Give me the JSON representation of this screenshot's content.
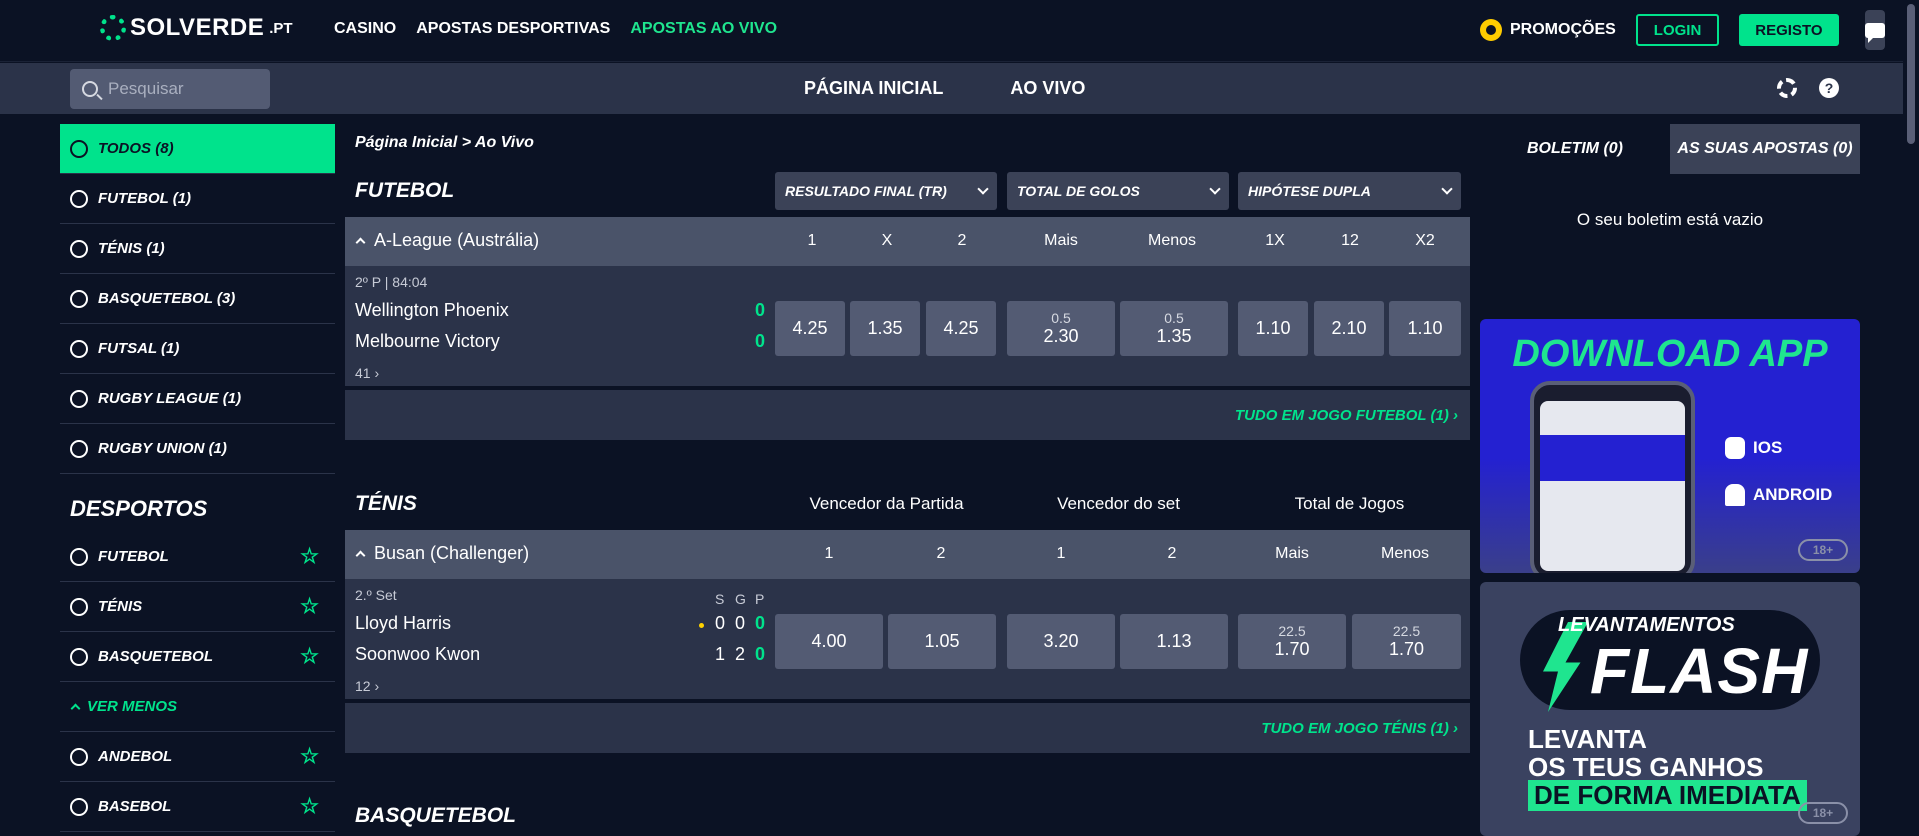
{
  "topnav": {
    "logo": "SOLVERDE",
    "logo_suffix": ".PT",
    "links": [
      "CASINO",
      "APOSTAS DESPORTIVAS",
      "APOSTAS AO VIVO"
    ],
    "active_link": 2,
    "promo": "PROMOÇÕES",
    "login": "LOGIN",
    "register": "REGISTO"
  },
  "subnav": {
    "search_placeholder": "Pesquisar",
    "tabs": [
      "PÁGINA INICIAL",
      "AO VIVO"
    ]
  },
  "sidebar": {
    "live_items": [
      {
        "label": "TODOS (8)",
        "icon": "all-sports-icon",
        "active": true
      },
      {
        "label": "FUTEBOL (1)",
        "icon": "football-icon"
      },
      {
        "label": "TÉNIS (1)",
        "icon": "tennis-icon"
      },
      {
        "label": "BASQUETEBOL (3)",
        "icon": "basketball-icon"
      },
      {
        "label": "FUTSAL (1)",
        "icon": "futsal-icon"
      },
      {
        "label": "RUGBY LEAGUE (1)",
        "icon": "rugby-icon"
      },
      {
        "label": "RUGBY UNION (1)",
        "icon": "rugby-icon"
      }
    ],
    "sports_title": "DESPORTOS",
    "sports": [
      {
        "label": "FUTEBOL",
        "icon": "football-icon"
      },
      {
        "label": "TÉNIS",
        "icon": "tennis-icon"
      },
      {
        "label": "BASQUETEBOL",
        "icon": "basketball-icon"
      }
    ],
    "ver_menos": "VER MENOS",
    "more_sports": [
      {
        "label": "ANDEBOL",
        "icon": "handball-icon"
      },
      {
        "label": "BASEBOL",
        "icon": "baseball-icon"
      }
    ]
  },
  "main": {
    "breadcrumb": "Página Inicial > Ao Vivo",
    "football": {
      "title": "FUTEBOL",
      "dropdowns": [
        "RESULTADO FINAL (TR)",
        "TOTAL DE GOLOS",
        "HIPÓTESE DUPLA"
      ],
      "league": "A-League (Austrália)",
      "columns": [
        "1",
        "X",
        "2",
        "Mais",
        "Menos",
        "1X",
        "12",
        "X2"
      ],
      "period": "2º P",
      "time": "84:04",
      "home": "Wellington Phoenix",
      "away": "Melbourne Victory",
      "home_score": "0",
      "away_score": "0",
      "more": "41",
      "odds": [
        "4.25",
        "1.35",
        "4.25",
        "2.30",
        "1.35",
        "1.10",
        "2.10",
        "1.10"
      ],
      "lines": [
        "0.5",
        "0.5"
      ],
      "all_link": "TUDO EM JOGO FUTEBOL (1)"
    },
    "tennis": {
      "title": "TÉNIS",
      "market_heads": [
        "Vencedor da Partida",
        "Vencedor do set",
        "Total de Jogos"
      ],
      "league": "Busan (Challenger)",
      "columns": [
        "1",
        "2",
        "1",
        "2",
        "Mais",
        "Menos"
      ],
      "period": "2.º Set",
      "sgp": [
        "S",
        "G",
        "P"
      ],
      "home": "Lloyd Harris",
      "away": "Soonwoo Kwon",
      "home_scores": [
        "0",
        "0",
        "0"
      ],
      "away_scores": [
        "1",
        "2",
        "0"
      ],
      "more": "12",
      "odds": [
        "4.00",
        "1.05",
        "3.20",
        "1.13",
        "1.70",
        "1.70"
      ],
      "lines": [
        "22.5",
        "22.5"
      ],
      "all_link": "TUDO EM JOGO TÉNIS (1)"
    },
    "basketball_title": "BASQUETEBOL"
  },
  "betslip": {
    "tabs": [
      "BOLETIM (0)",
      "AS SUAS APOSTAS (0)"
    ],
    "empty": "O seu boletim está vazio"
  },
  "banners": {
    "app": {
      "title": "DOWNLOAD APP",
      "ios": "IOS",
      "android": "ANDROID",
      "age": "18+"
    },
    "flash": {
      "top": "LEVANTAMENTOS",
      "word": "FLASH",
      "l1": "LEVANTA",
      "l2": "OS TEUS GANHOS",
      "l3": "DE FORMA IMEDIATA",
      "age": "18+"
    }
  },
  "colors": {
    "accent": "#00e38c",
    "bg": "#0b1224",
    "panel": "#2b3349"
  }
}
